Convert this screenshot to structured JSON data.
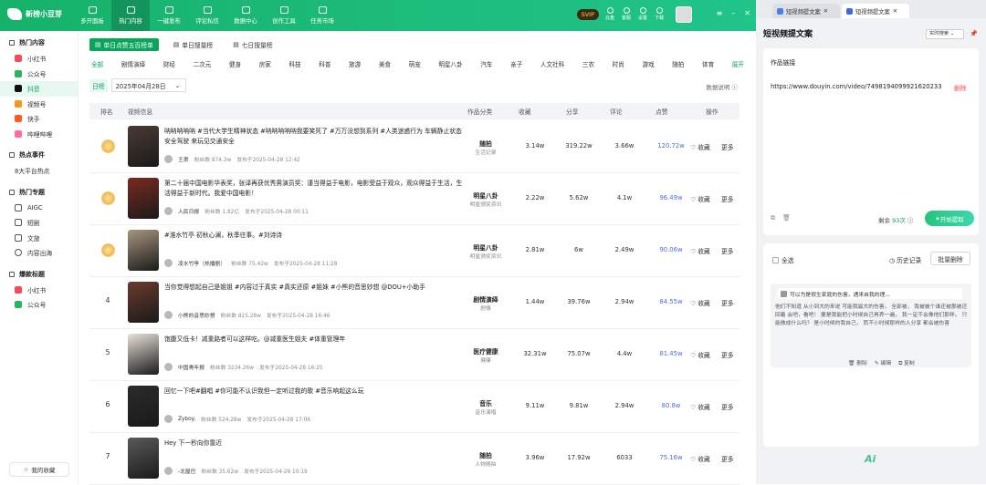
{
  "app": {
    "logo": "新榜小豆芽",
    "svip": "SVIP"
  },
  "nav": [
    {
      "label": "多开面板"
    },
    {
      "label": "热门内容"
    },
    {
      "label": "一键发布"
    },
    {
      "label": "评论私信"
    },
    {
      "label": "数据中心"
    },
    {
      "label": "创作工具"
    },
    {
      "label": "任务市场"
    }
  ],
  "top_icons": [
    "云盘",
    "客服",
    "设置",
    "下载"
  ],
  "sidebar": {
    "h1": "热门内容",
    "items1": [
      "小红书",
      "公众号",
      "抖音",
      "视频号",
      "快手",
      "哔哩哔哩"
    ],
    "h2": "热点事件",
    "items2": [
      "8大平台热点"
    ],
    "h3": "热门专题",
    "items3": [
      "AIGC",
      "短剧",
      "文旅",
      "内容出海"
    ],
    "h4": "爆款标题",
    "items4": [
      "小红书",
      "公众号"
    ],
    "fav": "我的收藏"
  },
  "filter_tabs": [
    "单日点赞五百榜单",
    "单日搜量榜",
    "七日搜量榜"
  ],
  "categories": [
    "全部",
    "剧情演绎",
    "财经",
    "二次元",
    "健身",
    "房家",
    "科技",
    "科普",
    "旅游",
    "美食",
    "萌宠",
    "明星八卦",
    "汽车",
    "亲子",
    "人文社科",
    "三农",
    "时尚",
    "游戏",
    "随拍",
    "体育",
    "展开"
  ],
  "date": {
    "label": "日榜",
    "value": "2025年04月28日",
    "note": "数据说明"
  },
  "table": {
    "headers": [
      "排名",
      "视频信息",
      "作品分类",
      "收藏",
      "分享",
      "评论",
      "点赞",
      "操作"
    ]
  },
  "rows": [
    {
      "rank": "",
      "title": "呐呐呐呐呐 #当代大学生精神状态 #呐呐呐呐呐我要笑死了 #万万没想到系列 #人类迷惑行为 车辆静止状态 安全驾驶 来玩见交通安全",
      "author": "王肃",
      "fans": "粉丝数 874.3w",
      "pub": "发布于2025-04-28 12:42",
      "cat": "随拍",
      "sub": "生活记录",
      "fav": "3.14w",
      "share": "319.22w",
      "comment": "3.66w",
      "like": "120.72w",
      "color": "#4a3b32"
    },
    {
      "rank": "",
      "title": "第二十届中国电影华表奖，张译再获优秀男演员奖：谨当得益于电影，电影受益于观众，观众得益于生活，生活得益于新时代。我爱中国电影！",
      "author": "人民日报",
      "fans": "粉丝数 1.82亿",
      "pub": "发布于2025-04-28 00:11",
      "cat": "明星八卦",
      "sub": "明星颁奖资讯",
      "fav": "2.22w",
      "share": "5.62w",
      "comment": "4.1w",
      "like": "96.49w",
      "color": "#7a2b1f"
    },
    {
      "rank": "",
      "title": "#淮水竹亭 初秋心澜，秋季往事。#刘诗诗",
      "author": "凌水竹亭（热播剧）",
      "fans": "粉丝数 75.42w",
      "pub": "发布于2025-04-28 11:28",
      "cat": "明星八卦",
      "sub": "明星颁奖资讯",
      "fav": "2.81w",
      "share": "6w",
      "comment": "2.49w",
      "like": "90.06w",
      "color": "#a89680"
    },
    {
      "rank": "4",
      "title": "当你觉得想起自己是姐姐 #内容过于真实 #真实还原 #姐妹 #小熊的音思妙想 @DOU+小助手",
      "author": "小熊的音思妙想",
      "fans": "粉丝数 825.28w",
      "pub": "发布于2025-04-28 16:46",
      "cat": "剧情演绎",
      "sub": "剧情",
      "fav": "1.44w",
      "share": "39.76w",
      "comment": "2.94w",
      "like": "84.55w",
      "color": "#6b3b2e"
    },
    {
      "rank": "5",
      "title": "饱腹又低卡！减重路者可以这样吃。@减重医生姐夫 #体重管理年",
      "author": "中国青年报",
      "fans": "粉丝数 3234.26w",
      "pub": "发布于2025-04-28 16:25",
      "cat": "医疗健康",
      "sub": "健康",
      "fav": "32.31w",
      "share": "75.07w",
      "comment": "4.4w",
      "like": "81.45w",
      "color": "#e9e2da"
    },
    {
      "rank": "6",
      "title": "回忆一下吧#翻唱 #你可能不认识我但一定听过我的歌 #音乐响起这么玩",
      "author": "Zyboy.",
      "fans": "粉丝数 524.28w",
      "pub": "发布于2025-04-28 17:06",
      "cat": "音乐",
      "sub": "音乐演唱",
      "fav": "9.11w",
      "share": "9.81w",
      "comment": "2.94w",
      "like": "80.8w",
      "color": "#2b2b2b"
    },
    {
      "rank": "7",
      "title": "Hey 下一秒向你靠近",
      "author": "-北屋巴",
      "fans": "粉丝数 35.62w",
      "pub": "发布于2025-04-28 10:19",
      "cat": "随拍",
      "sub": "人物随拍",
      "fav": "3.96w",
      "share": "17.92w",
      "comment": "6033",
      "like": "75.16w",
      "color": "#5a5a5a"
    }
  ],
  "row_actions": {
    "fav": "收藏",
    "more": "更多"
  },
  "right": {
    "tabs": [
      "短视频提文案",
      "短视频提文案"
    ],
    "title": "短视频提文案",
    "select": "实时搜索",
    "input_label": "作品链接",
    "url": "https://www.douyin.com/video/7498194099921620233",
    "del": "删除",
    "remain_label": "剩余",
    "remain": "93次",
    "start": "开始提取",
    "select_all": "全选",
    "history": "历史记录",
    "batch_del": "批量删除",
    "item_title": "可以为是很生家庭的伤害，遇来自我的理...",
    "item_text": "他们不知道 从小到大的来说 可能我最大的伤害， 全部被， 我被被个谁还被那被还回着 会吧，看吧！ 要是我能把小时候自己再养一遍， 我一定不会像他们那样。 只能做成什么吗？ 是小时候的我自己， 而不小时候那样的人分享 都会被伤害",
    "item_actions": [
      "删除",
      "编辑",
      "复制"
    ],
    "logo": "Ai"
  }
}
